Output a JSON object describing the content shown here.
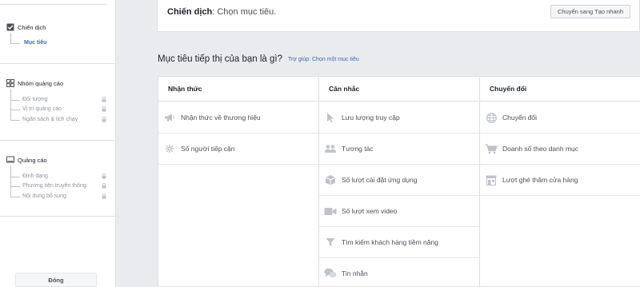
{
  "sidebar": {
    "campaign": {
      "title": "Chiến dịch",
      "sub": "Mục tiêu"
    },
    "adset": {
      "title": "Nhóm quảng cáo",
      "items": [
        "Đối tượng",
        "Vị trí quảng cáo",
        "Ngân sách & lịch chạy"
      ]
    },
    "ad": {
      "title": "Quảng cáo",
      "items": [
        "Định dạng",
        "Phương tiện truyền thông",
        "Nội dung bổ sung"
      ]
    },
    "close_label": "Đóng"
  },
  "header": {
    "campaign_label": "Chiến dịch",
    "campaign_value": ": Chọn mục tiêu.",
    "quick_create_label": "Chuyển sang Tạo nhanh"
  },
  "objectives": {
    "question": "Mục tiêu tiếp thị của bạn là gì?",
    "help": "Trợ giúp: Chọn một mục tiêu",
    "columns": [
      {
        "title": "Nhận thức",
        "items": [
          {
            "label": "Nhận thức về thương hiệu",
            "icon": "megaphone-icon"
          },
          {
            "label": "Số người tiếp cận",
            "icon": "reach-snowflake-icon"
          }
        ]
      },
      {
        "title": "Cân nhắc",
        "items": [
          {
            "label": "Lưu lượng truy cập",
            "icon": "cursor-icon"
          },
          {
            "label": "Tương tác",
            "icon": "people-icon"
          },
          {
            "label": "Số lượt cài đặt ứng dụng",
            "icon": "box-icon"
          },
          {
            "label": "Số lượt xem video",
            "icon": "video-camera-icon"
          },
          {
            "label": "Tìm kiếm khách hàng tiềm năng",
            "icon": "funnel-icon"
          },
          {
            "label": "Tin nhắn",
            "icon": "chat-bubbles-icon"
          }
        ]
      },
      {
        "title": "Chuyển đổi",
        "items": [
          {
            "label": "Chuyển đổi",
            "icon": "globe-icon"
          },
          {
            "label": "Doanh số theo danh mục",
            "icon": "shopping-cart-icon"
          },
          {
            "label": "Lượt ghé thăm cửa hàng",
            "icon": "store-icon"
          }
        ]
      }
    ]
  },
  "colors": {
    "accent": "#4267b2",
    "icon_gray": "#bec2c9",
    "border": "#dddfe2",
    "background": "#e9ebee"
  }
}
